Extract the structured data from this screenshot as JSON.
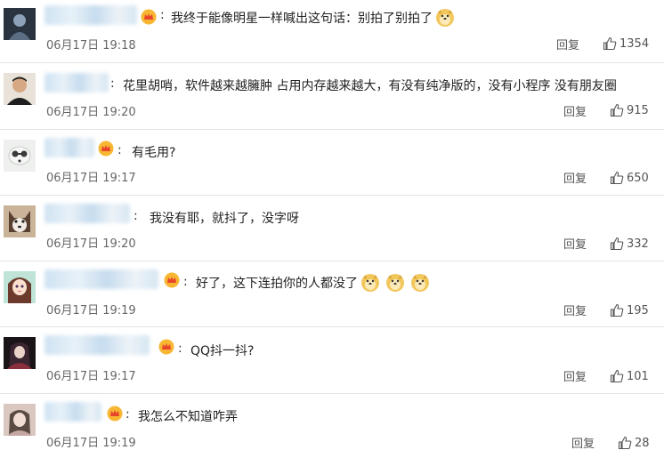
{
  "comments": [
    {
      "text": "我终于能像明星一样喊出这句话：别拍了别拍了",
      "emojis": [
        "doge"
      ],
      "time": "06月17日  19:18",
      "reply": "回复",
      "likes": "1354",
      "vip": true
    },
    {
      "text": "花里胡哨，软件越来越臃肿 占用内存越来越大，有没有纯净版的，没有小程序 没有朋友圈",
      "emojis": [],
      "time": "06月17日  19:20",
      "reply": "回复",
      "likes": "915",
      "vip": false
    },
    {
      "text": "有毛用?",
      "emojis": [],
      "time": "06月17日  19:17",
      "reply": "回复",
      "likes": "650",
      "vip": true
    },
    {
      "text": "我没有耶，就抖了，没字呀",
      "emojis": [],
      "time": "06月17日  19:20",
      "reply": "回复",
      "likes": "332",
      "vip": false
    },
    {
      "text": "好了，这下连拍你的人都没了",
      "emojis": [
        "doge",
        "doge",
        "doge"
      ],
      "time": "06月17日  19:19",
      "reply": "回复",
      "likes": "195",
      "vip": true
    },
    {
      "text": "QQ抖一抖?",
      "emojis": [],
      "time": "06月17日  19:17",
      "reply": "回复",
      "likes": "101",
      "vip": true
    },
    {
      "text": "我怎么不知道咋弄",
      "emojis": [],
      "time": "06月17日  19:19",
      "reply": "回复",
      "likes": "28",
      "vip": true
    }
  ],
  "colors": {
    "divider": "#e3e3e3",
    "vip_badge": "#f5a623",
    "name_blur": "#cfe3f3"
  },
  "icons": {
    "like": "thumbs-up-icon",
    "vip": "vip-crown-icon",
    "emoji": "doge-emoji-icon"
  }
}
